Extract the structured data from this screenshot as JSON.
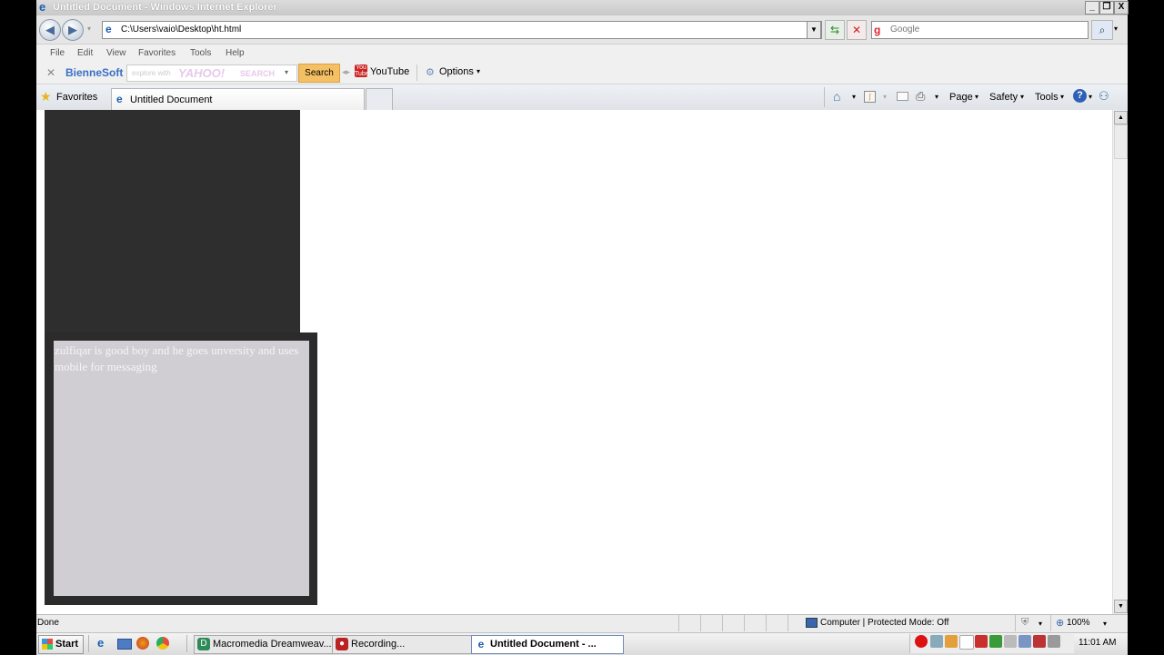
{
  "window": {
    "title": "Untitled Document - Windows Internet Explorer",
    "minimize_glyph": "_",
    "restore_glyph": "❐",
    "close_glyph": "X"
  },
  "nav": {
    "address": "C:\\Users\\vaio\\Desktop\\ht.html",
    "search_placeholder": "Google"
  },
  "menu": {
    "items": [
      "File",
      "Edit",
      "View",
      "Favorites",
      "Tools",
      "Help"
    ]
  },
  "toolbar2": {
    "brand": "BienneSoft",
    "yahoo_prefix": "explore with",
    "yahoo_logo": "YAHOO!",
    "yahoo_search_word": "SEARCH",
    "search_button": "Search",
    "youtube": "YouTube",
    "options": "Options"
  },
  "tabs": {
    "favorites": "Favorites",
    "active_tab": "Untitled Document"
  },
  "command_bar": {
    "page": "Page",
    "safety": "Safety",
    "tools": "Tools"
  },
  "page": {
    "paragraph": "zulfiqar is good boy and he goes unversity and uses mobile for messaging"
  },
  "status": {
    "left": "Done",
    "zone": "Computer | Protected Mode: Off",
    "zoom": "100%"
  },
  "taskbar": {
    "start": "Start",
    "tasks": [
      "Macromedia Dreamweav...",
      "Recording...",
      "Untitled Document - ..."
    ],
    "clock": "11:01 AM"
  },
  "colors": {
    "dark_panel": "#2e2e2e",
    "text_box": "#d1ced3",
    "text_box_border": "#2b2b2b",
    "paragraph_text": "#f4f4f4",
    "search_button": "#f5c063"
  }
}
